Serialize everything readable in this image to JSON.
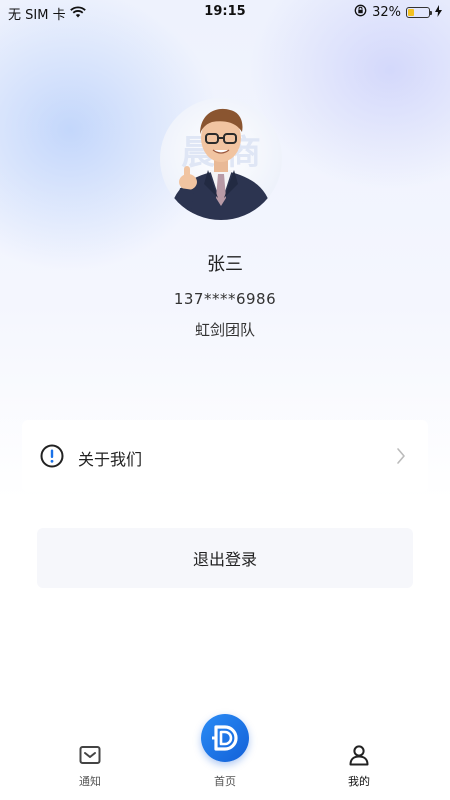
{
  "status_bar": {
    "carrier": "无 SIM 卡",
    "time": "19:15",
    "battery_percent": "32%",
    "battery_level": 0.32
  },
  "profile": {
    "name": "张三",
    "phone": "137****6986",
    "team": "虹剑团队"
  },
  "menu": {
    "about_label": "关于我们"
  },
  "actions": {
    "logout_label": "退出登录"
  },
  "tabbar": {
    "items": [
      {
        "label": "通知",
        "icon": "mail-icon"
      },
      {
        "label": "首页",
        "icon": "home-logo-icon"
      },
      {
        "label": "我的",
        "icon": "person-icon",
        "active": true
      }
    ]
  },
  "colors": {
    "accent": "#1A72E8",
    "battery": "#F2C020"
  }
}
